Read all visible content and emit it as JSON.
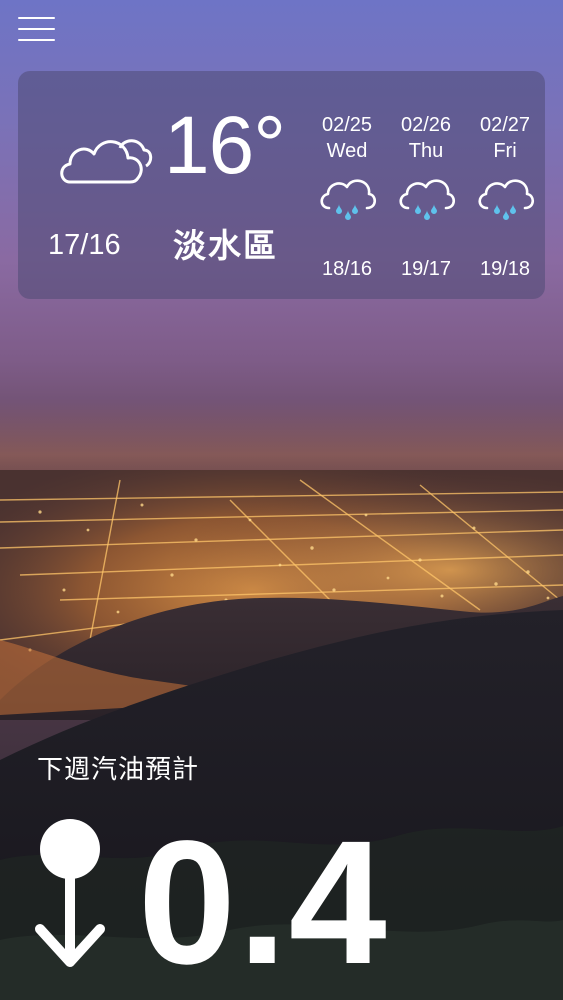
{
  "menu": {
    "icon": "hamburger-menu-icon"
  },
  "weather": {
    "current": {
      "icon": "partly-cloudy-icon",
      "temperature": "16°",
      "hi_lo": "17/16",
      "location": "淡水區"
    },
    "forecast": [
      {
        "date": "02/25",
        "weekday": "Wed",
        "icon": "rain-cloud-icon",
        "temps": "18/16"
      },
      {
        "date": "02/26",
        "weekday": "Thu",
        "icon": "rain-cloud-icon",
        "temps": "19/17"
      },
      {
        "date": "02/27",
        "weekday": "Fri",
        "icon": "rain-cloud-icon",
        "temps": "19/18"
      }
    ],
    "raindrop_color": "#5fc2ec"
  },
  "gas": {
    "title": "下週汽油預計",
    "direction_icon": "down-arrow-icon",
    "value": "0.4"
  }
}
